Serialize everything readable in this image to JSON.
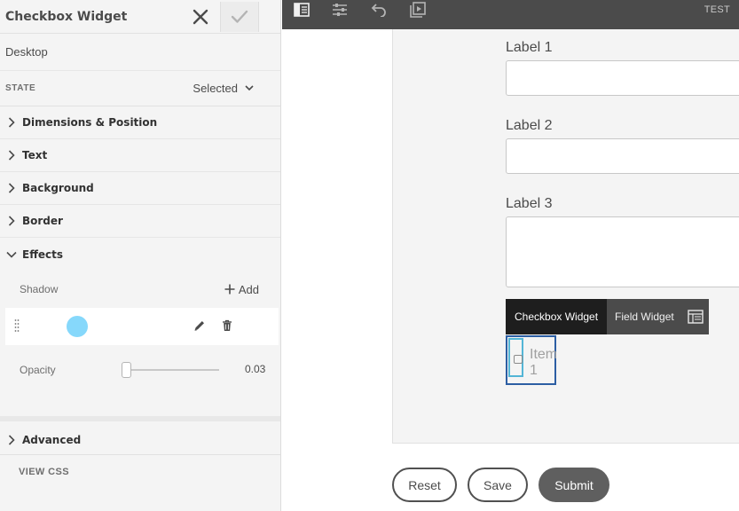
{
  "panel": {
    "title": "Checkbox Widget",
    "device": "Desktop",
    "state_label": "STATE",
    "state_value": "Selected",
    "sections": {
      "dimensions": "Dimensions & Position",
      "text": "Text",
      "background": "Background",
      "border": "Border",
      "effects": "Effects",
      "advanced": "Advanced"
    },
    "shadow_label": "Shadow",
    "add_label": "Add",
    "shadow_color": "#86d8fb",
    "opacity_label": "Opacity",
    "opacity_value": "0.03",
    "view_css": "VIEW CSS"
  },
  "toolbar": {
    "icons": [
      "sidebar-toggle-icon",
      "properties-icon",
      "undo-icon",
      "preview-icon"
    ],
    "test_label": "TEST"
  },
  "form": {
    "fields": [
      {
        "label": "Label 1"
      },
      {
        "label": "Label 2"
      },
      {
        "label": "Label 3"
      }
    ],
    "widget_bar": {
      "checkbox_widget": "Checkbox Widget",
      "field_widget": "Field Widget"
    },
    "item_label": "Item 1",
    "buttons": {
      "reset": "Reset",
      "save": "Save",
      "submit": "Submit"
    }
  },
  "colors": {
    "toolbar_bg": "#4b4b4b",
    "selection_outline": "#2c5ea3",
    "inner_outline": "#53b5d6",
    "submit_bg": "#5f5f5f"
  }
}
